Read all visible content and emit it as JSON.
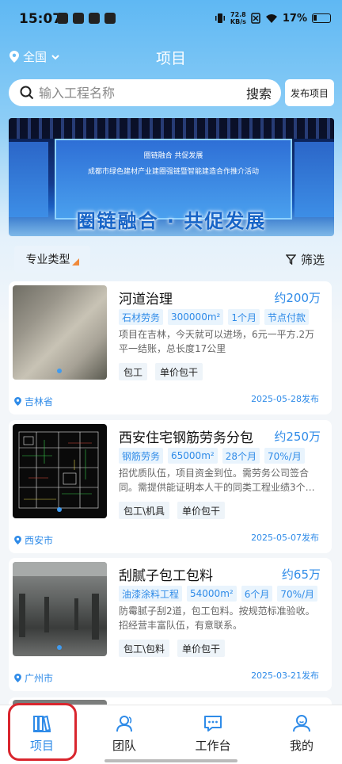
{
  "status_bar": {
    "time": "15:07",
    "net_speed_value": "72.8",
    "net_speed_unit": "KB/s",
    "battery": "17%"
  },
  "header": {
    "location": "全国",
    "title": "项目"
  },
  "search": {
    "placeholder": "输入工程名称",
    "button": "搜索",
    "publish": "发布项目"
  },
  "banner": {
    "screen_title": "圈链融合   共促发展",
    "screen_subtitle": "成都市绿色建材产业建圈强链暨智能建造合作推介活动",
    "slogan": "圈链融合 · 共促发展"
  },
  "filters": {
    "type_label": "专业类型",
    "screen_label": "筛选"
  },
  "projects": [
    {
      "title": "河道治理",
      "price": "约200万",
      "tags": [
        "石材劳务",
        "300000m²",
        "1个月",
        "节点付款"
      ],
      "desc": "项目在吉林，今天就可以进场，6元一平方.2万平一结账，总长度17公里",
      "chips": [
        "包工",
        "单价包干"
      ],
      "location": "吉林省",
      "date": "2025-05-28发布"
    },
    {
      "title": "西安住宅钢筋劳务分包",
      "price": "约250万",
      "tags": [
        "钢筋劳务",
        "65000m²",
        "28个月",
        "70%/月"
      ],
      "desc": "招优质队伍，项目资金到位。需劳务公司签合同。需提供能证明本人干的同类工程业绩3个…",
      "chips": [
        "包工\\机具",
        "单价包干"
      ],
      "location": "西安市",
      "date": "2025-05-07发布"
    },
    {
      "title": "刮腻子包工包料",
      "price": "约65万",
      "tags": [
        "油漆涂料工程",
        "54000m²",
        "6个月",
        "70%/月"
      ],
      "desc": "防霉腻子刮2道，包工包料。按规范标准验收。招经营丰富队伍，有意联系。",
      "chips": [
        "包工\\包料",
        "单价包干"
      ],
      "location": "广州市",
      "date": "2025-03-21发布"
    }
  ],
  "tabbar": [
    {
      "label": "项目",
      "icon": "books-icon",
      "active": true
    },
    {
      "label": "团队",
      "icon": "team-icon",
      "active": false
    },
    {
      "label": "工作台",
      "icon": "chat-icon",
      "active": false
    },
    {
      "label": "我的",
      "icon": "profile-icon",
      "active": false
    }
  ],
  "colors": {
    "accent": "#2f8be8",
    "highlight": "#d9262e",
    "price_tag_bg": "#e9f4fd"
  }
}
